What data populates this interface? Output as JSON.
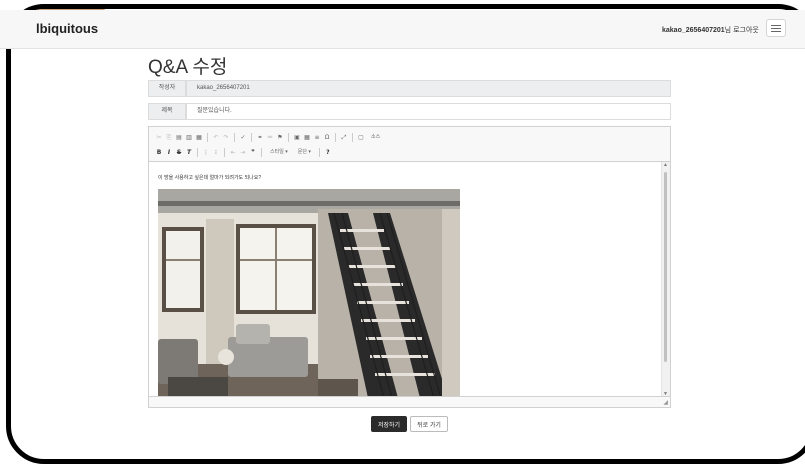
{
  "navbar": {
    "brand": "lbiquitous",
    "username": "kakao_2656407201",
    "user_suffix": "님",
    "logout_label": "로그아웃"
  },
  "page": {
    "title": "Q&A 수정"
  },
  "form": {
    "author_label": "작성자",
    "author_value": "kakao_2656407201",
    "subject_label": "제목",
    "subject_value": "질문있습니다."
  },
  "editor": {
    "toolbar": {
      "source_label": "소스",
      "style_combo": "스타일",
      "format_combo": "문단",
      "help_label": "?"
    },
    "content_text": "이 방을 사용하고 싶은데 얼마가 되려가도 되나요?",
    "image_description_icon": "loft-room-photo"
  },
  "actions": {
    "save_label": "저장하기",
    "back_label": "뒤로 가기"
  },
  "colors": {
    "frame": "#000000",
    "save_button": "#2b2b2b",
    "label_bg": "#eceef0"
  }
}
